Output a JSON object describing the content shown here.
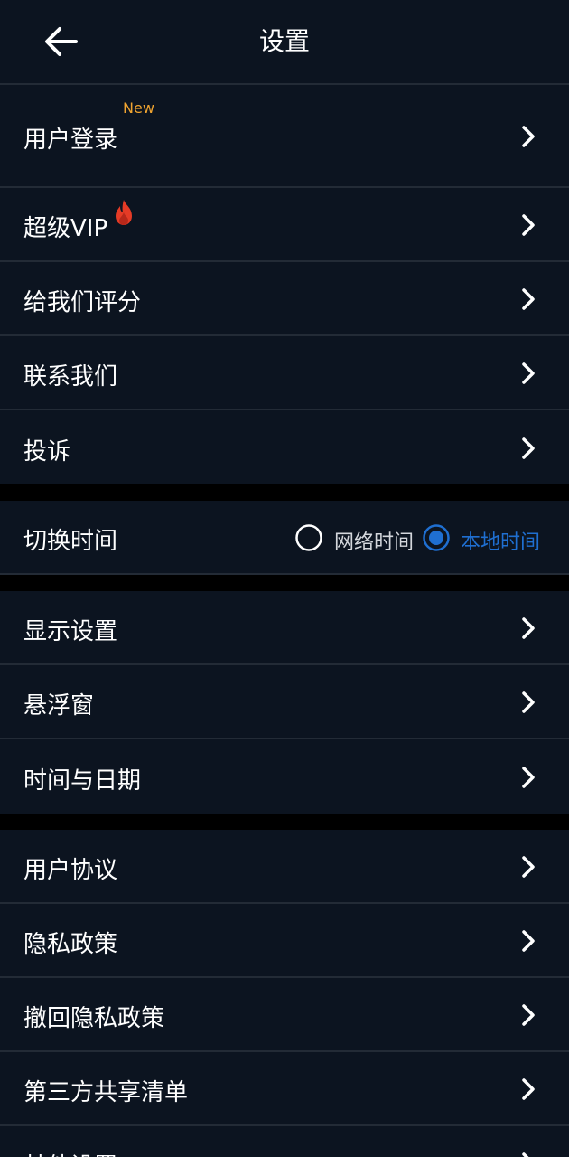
{
  "header": {
    "title": "设置",
    "back_icon": "arrow-left-icon"
  },
  "groups": {
    "account": {
      "login": {
        "label": "用户登录",
        "badge": "New"
      },
      "vip": {
        "label": "超级VIP",
        "icon": "fire-icon"
      },
      "rate": {
        "label": "给我们评分"
      },
      "contact": {
        "label": "联系我们"
      },
      "complain": {
        "label": "投诉"
      }
    },
    "time_switch": {
      "label": "切换时间",
      "options": [
        {
          "label": "网络时间",
          "selected": false
        },
        {
          "label": "本地时间",
          "selected": true
        }
      ]
    },
    "display": {
      "display_settings": {
        "label": "显示设置"
      },
      "float_window": {
        "label": "悬浮窗"
      },
      "time_date": {
        "label": "时间与日期"
      }
    },
    "legal": {
      "user_agreement": {
        "label": "用户协议"
      },
      "privacy_policy": {
        "label": "隐私政策"
      },
      "revoke_privacy": {
        "label": "撤回隐私政策"
      },
      "third_party": {
        "label": "第三方共享清单"
      },
      "other": {
        "label": "其他设置"
      }
    }
  },
  "colors": {
    "background": "#0c1420",
    "separator": "#000000",
    "divider": "#232b36",
    "accent_blue": "#1f6fd1",
    "badge_orange": "#f0a430",
    "fire_red": "#e53b26"
  }
}
